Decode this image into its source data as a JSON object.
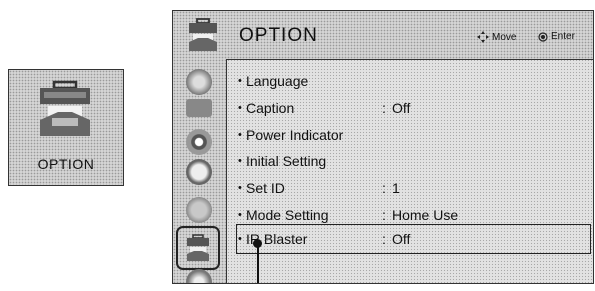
{
  "tile": {
    "label": "OPTION",
    "icon": "option-toolbox-icon"
  },
  "header": {
    "title": "OPTION",
    "icon": "option-toolbox-icon",
    "hints": {
      "move": "Move",
      "enter": "Enter"
    }
  },
  "sidebar": {
    "icons": [
      "picture-icon",
      "screen-icon",
      "audio-icon",
      "time-icon",
      "lock-icon",
      "option-icon",
      "input-icon"
    ],
    "selected_index": 5
  },
  "menu": {
    "items": [
      {
        "label": "Language",
        "value": ""
      },
      {
        "label": "Caption",
        "value": "Off"
      },
      {
        "label": "Power Indicator",
        "value": ""
      },
      {
        "label": "Initial Setting",
        "value": ""
      },
      {
        "label": "Set ID",
        "value": "1"
      },
      {
        "label": "Mode Setting",
        "value": "Home Use"
      },
      {
        "label": "IR Blaster",
        "value": "Off"
      }
    ],
    "selected_index": 6
  }
}
